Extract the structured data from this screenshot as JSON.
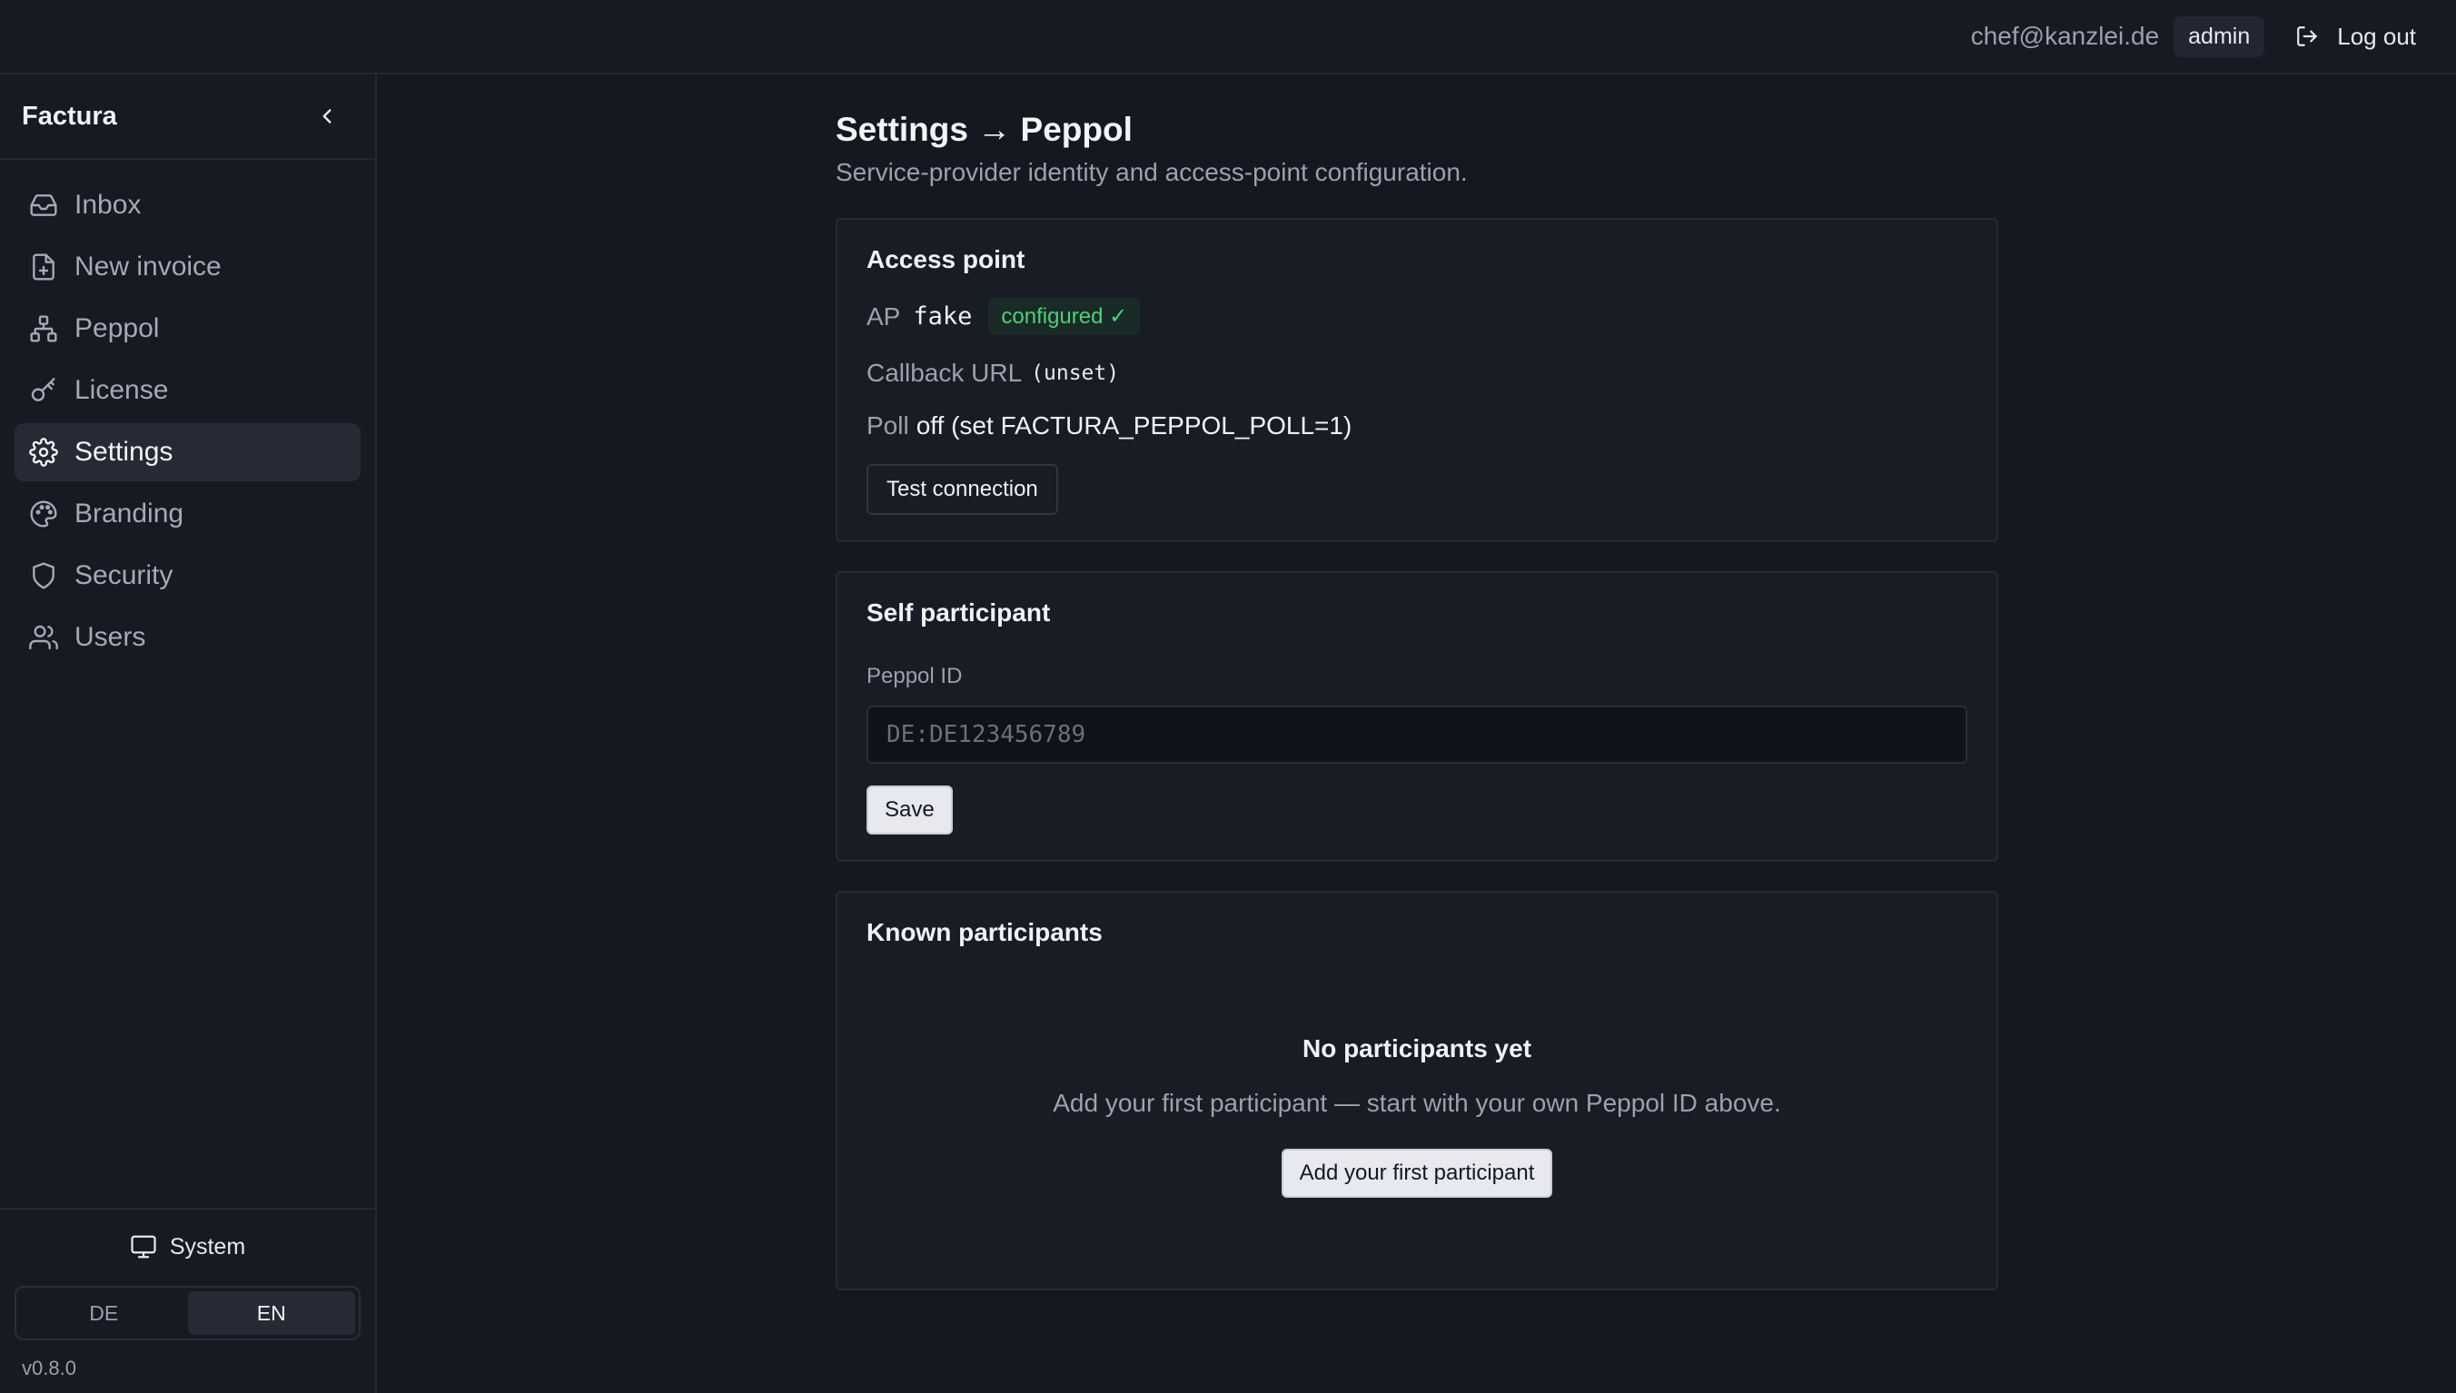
{
  "header": {
    "user_email": "chef@kanzlei.de",
    "role": "admin",
    "logout_label": "Log out"
  },
  "sidebar": {
    "brand": "Factura",
    "items": [
      {
        "label": "Inbox",
        "icon": "inbox-icon"
      },
      {
        "label": "New invoice",
        "icon": "file-plus-icon"
      },
      {
        "label": "Peppol",
        "icon": "network-icon"
      },
      {
        "label": "License",
        "icon": "key-icon"
      },
      {
        "label": "Settings",
        "icon": "gear-icon",
        "active": true
      },
      {
        "label": "Branding",
        "icon": "palette-icon"
      },
      {
        "label": "Security",
        "icon": "shield-icon"
      },
      {
        "label": "Users",
        "icon": "users-icon"
      }
    ],
    "theme_label": "System",
    "languages": [
      "DE",
      "EN"
    ],
    "active_language": "EN",
    "version": "v0.8.0"
  },
  "page": {
    "title": "Settings → Peppol",
    "subtitle": "Service-provider identity and access-point configuration."
  },
  "access_point": {
    "title": "Access point",
    "ap_label": "AP",
    "ap_value": "fake",
    "status_badge": "configured ✓",
    "callback_label": "Callback URL",
    "callback_value": "(unset)",
    "poll_label": "Poll",
    "poll_value": "off (set FACTURA_PEPPOL_POLL=1)",
    "test_button": "Test connection"
  },
  "self_participant": {
    "title": "Self participant",
    "field_label": "Peppol ID",
    "placeholder": "DE:DE123456789",
    "value": "",
    "save_button": "Save"
  },
  "known_participants": {
    "title": "Known participants",
    "empty_title": "No participants yet",
    "empty_description": "Add your first participant — start with your own Peppol ID above.",
    "add_button": "Add your first participant"
  },
  "colors": {
    "background": "#151821",
    "surface": "#181c25",
    "success": "#4cd07a",
    "muted_text": "#9ba1ad"
  }
}
